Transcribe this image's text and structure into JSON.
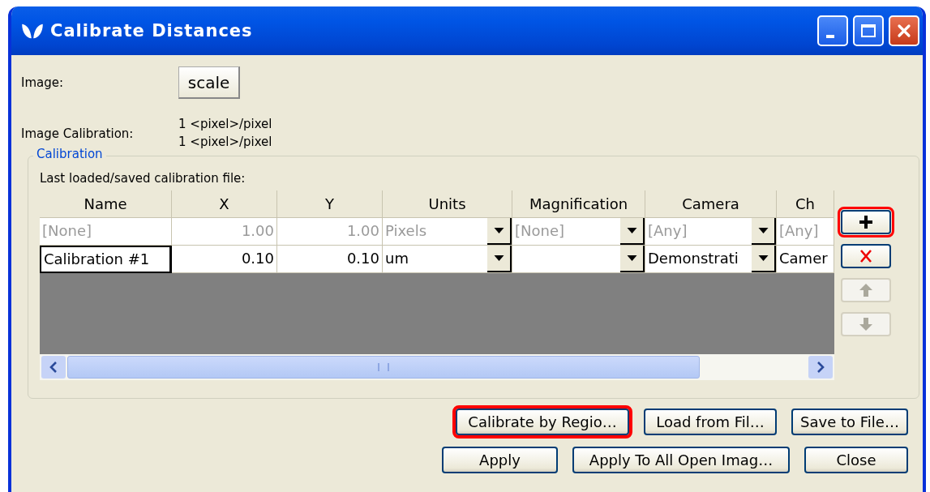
{
  "window": {
    "title": "Calibrate Distances"
  },
  "image": {
    "label": "Image:",
    "button": "scale"
  },
  "image_calibration": {
    "label": "Image Calibration:",
    "values": [
      "1 <pixel>/pixel",
      "1 <pixel>/pixel"
    ]
  },
  "calibration": {
    "title": "Calibration",
    "file_label": "Last loaded/saved calibration file:",
    "table": {
      "columns": [
        {
          "label": "Name",
          "kind": "text"
        },
        {
          "label": "X",
          "kind": "number"
        },
        {
          "label": "Y",
          "kind": "number"
        },
        {
          "label": "Units",
          "kind": "dropdown"
        },
        {
          "label": "Magnification",
          "kind": "dropdown"
        },
        {
          "label": "Camera",
          "kind": "dropdown"
        },
        {
          "label": "Ch",
          "kind": "text"
        }
      ],
      "rows": [
        {
          "dimmed": true,
          "editing": false,
          "cells": [
            "[None]",
            "1.00",
            "1.00",
            "Pixels",
            "[None]",
            "[Any]",
            "[Any]"
          ]
        },
        {
          "dimmed": false,
          "editing": true,
          "cells": [
            "Calibration #1",
            "0.10",
            "0.10",
            "um",
            "",
            "Demonstrati",
            "Camer"
          ]
        }
      ]
    },
    "side_buttons": [
      {
        "kind": "add",
        "disabled": false,
        "highlighted": true
      },
      {
        "kind": "delete",
        "disabled": false,
        "highlighted": false
      },
      {
        "kind": "up",
        "disabled": true,
        "highlighted": false
      },
      {
        "kind": "down",
        "disabled": true,
        "highlighted": false
      }
    ]
  },
  "buttons": [
    [
      {
        "label": "Calibrate by Regio…",
        "highlighted": true
      },
      {
        "label": "Load from Fil…",
        "highlighted": false
      },
      {
        "label": "Save to File…",
        "highlighted": false
      }
    ],
    [
      {
        "label": "Apply",
        "highlighted": false
      },
      {
        "label": "Apply To All Open Imag…",
        "highlighted": false
      },
      {
        "label": "Close",
        "highlighted": false
      }
    ]
  ]
}
